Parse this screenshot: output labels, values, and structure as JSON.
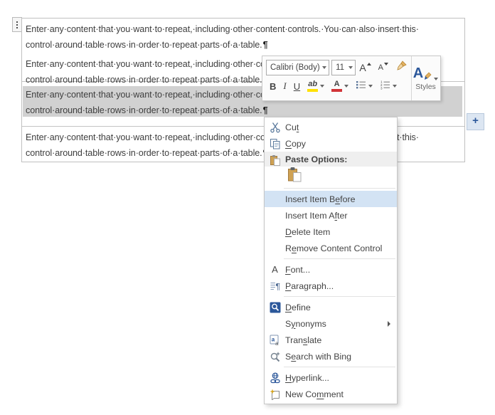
{
  "colors": {
    "accent-blue": "#2b579a",
    "menu-highlight": "#d3e3f4",
    "selection-gray": "#d1d1d1",
    "highlight-yellow": "#ffe100",
    "font-color-red": "#d13438"
  },
  "document": {
    "line1": "Enter·any·content·that·you·want·to·repeat,·including·other·content·controls.·You·can·also·insert·this·",
    "line2": "control·around·table·rows·in·order·to·repeat·parts·of·a·table.",
    "pilcrow": "¶",
    "paragraphs": [
      {
        "selected": false
      },
      {
        "selected": false
      },
      {
        "selected": true
      },
      {
        "selected": false
      }
    ],
    "add_item_label": "+"
  },
  "mini_toolbar": {
    "font_name": "Calibri (Body)",
    "font_size": "11",
    "grow_font": "A",
    "shrink_font": "A",
    "bold": "B",
    "italic": "I",
    "underline": "U",
    "highlight": "ab",
    "font_color": "A",
    "styles_letter": "A",
    "styles_label": "Styles"
  },
  "context_menu": {
    "items": [
      {
        "type": "item",
        "label": "Cut",
        "accel": 2,
        "icon": "scissors-icon"
      },
      {
        "type": "item",
        "label": "Copy",
        "accel": 0,
        "icon": "copy-icon"
      },
      {
        "type": "header",
        "label": "Paste Options:",
        "icon": "paste-icon"
      },
      {
        "type": "paste-option",
        "icon": "paste-keep-source-formatting-icon"
      },
      {
        "type": "separator"
      },
      {
        "type": "item",
        "label": "Insert Item Before",
        "accel": 13,
        "highlighted": true
      },
      {
        "type": "item",
        "label": "Insert Item After",
        "accel": 13
      },
      {
        "type": "item",
        "label": "Delete Item",
        "accel": 0
      },
      {
        "type": "item",
        "label": "Remove Content Control",
        "accel": 1
      },
      {
        "type": "separator"
      },
      {
        "type": "item",
        "label": "Font...",
        "accel": 0,
        "icon": "font-icon"
      },
      {
        "type": "item",
        "label": "Paragraph...",
        "accel": 0,
        "icon": "paragraph-icon"
      },
      {
        "type": "separator"
      },
      {
        "type": "item",
        "label": "Define",
        "accel": 0,
        "icon": "define-icon"
      },
      {
        "type": "item",
        "label": "Synonyms",
        "accel": 1,
        "submenu": true
      },
      {
        "type": "item",
        "label": "Translate",
        "accel": 4,
        "icon": "translate-icon"
      },
      {
        "type": "item",
        "label": "Search with Bing",
        "accel": 1,
        "icon": "bing-search-icon"
      },
      {
        "type": "separator"
      },
      {
        "type": "item",
        "label": "Hyperlink...",
        "accel": 0,
        "icon": "hyperlink-icon"
      },
      {
        "type": "item",
        "label": "New Comment",
        "accel": 6,
        "icon": "new-comment-icon"
      }
    ]
  }
}
